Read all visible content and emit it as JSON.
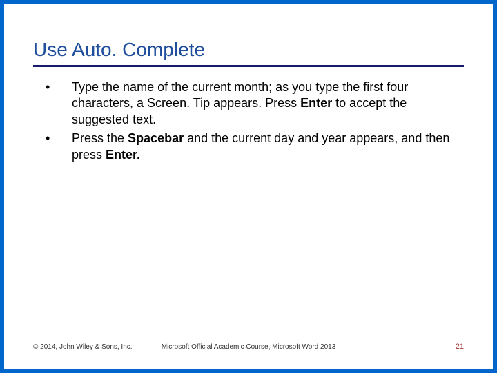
{
  "title": "Use Auto. Complete",
  "bullets": [
    {
      "pre": "Type the name of the current month; as you type the first four characters, a Screen. Tip appears. Press ",
      "bold1": "Enter",
      "post": " to accept the suggested text."
    },
    {
      "pre": "Press the ",
      "bold1": "Spacebar",
      "mid": " and the current day and year appears, and then press ",
      "bold2": "Enter.",
      "post": ""
    }
  ],
  "footer": {
    "left": "© 2014, John Wiley & Sons, Inc.",
    "center": "Microsoft Official Academic Course, Microsoft Word 2013",
    "right": "21"
  }
}
